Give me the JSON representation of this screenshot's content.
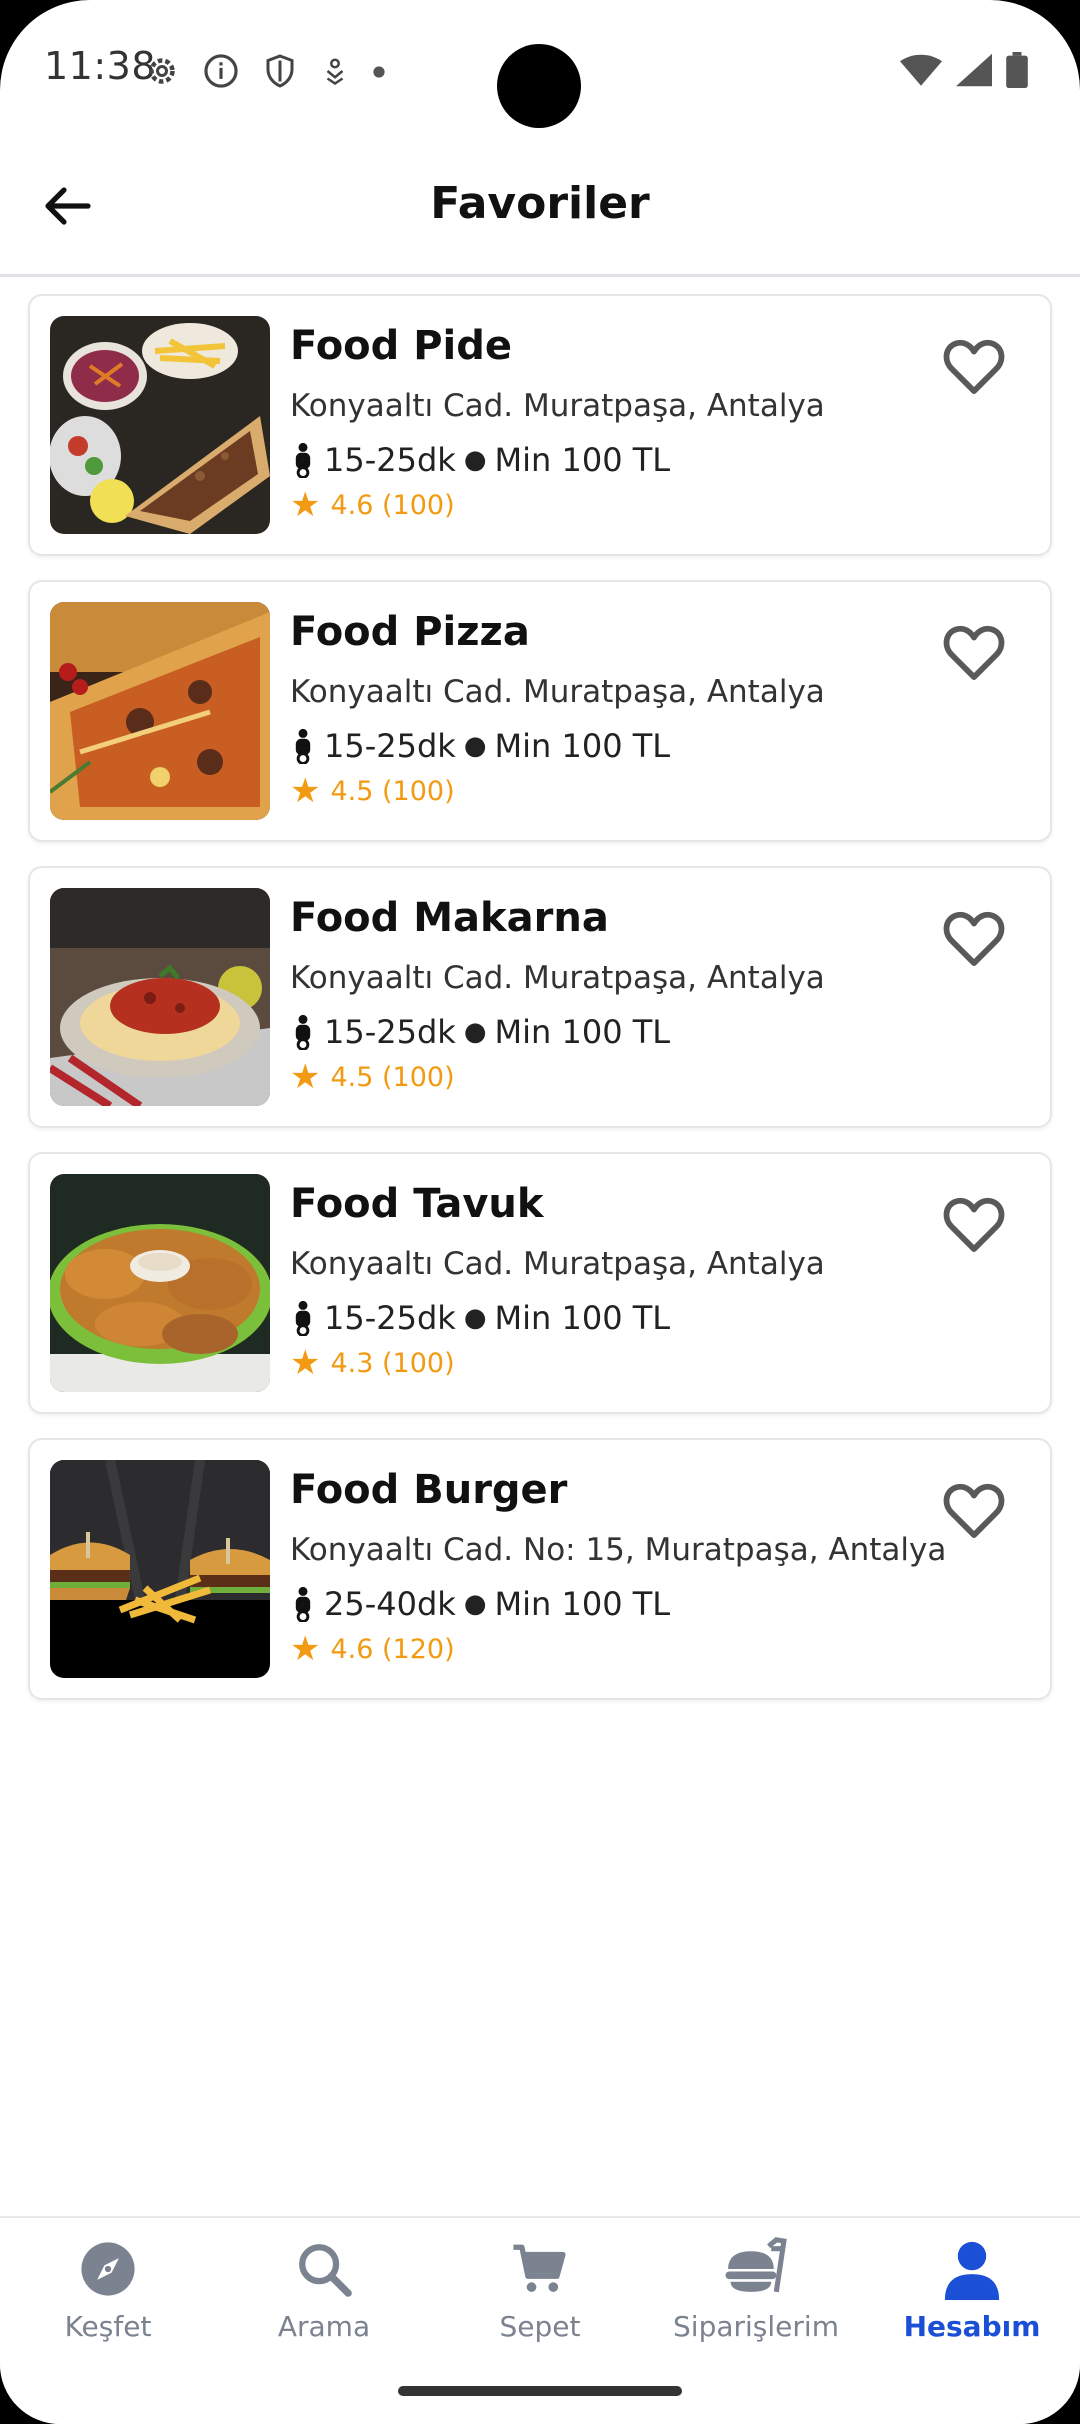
{
  "status_bar": {
    "time": "11:38",
    "icons_left": [
      "gear-icon",
      "info-icon",
      "shield-icon",
      "download-icon",
      "dot-icon"
    ],
    "icons_right": [
      "wifi-icon",
      "signal-icon",
      "battery-icon"
    ]
  },
  "header": {
    "title": "Favoriler",
    "back_icon": "arrow-left-icon"
  },
  "restaurants": [
    {
      "name": "Food Pide",
      "address": "Konyaaltı Cad. Muratpaşa, Antalya",
      "delivery_time": "15-25dk",
      "min_order": "Min 100 TL",
      "rating": "4.6 (100)",
      "favorite_icon": "heart-outline-icon"
    },
    {
      "name": "Food Pizza",
      "address": "Konyaaltı Cad. Muratpaşa, Antalya",
      "delivery_time": "15-25dk",
      "min_order": "Min 100 TL",
      "rating": "4.5 (100)",
      "favorite_icon": "heart-outline-icon"
    },
    {
      "name": "Food Makarna",
      "address": "Konyaaltı Cad. Muratpaşa, Antalya",
      "delivery_time": "15-25dk",
      "min_order": "Min 100 TL",
      "rating": "4.5 (100)",
      "favorite_icon": "heart-outline-icon"
    },
    {
      "name": "Food Tavuk",
      "address": "Konyaaltı Cad. Muratpaşa, Antalya",
      "delivery_time": "15-25dk",
      "min_order": "Min 100 TL",
      "rating": "4.3 (100)",
      "favorite_icon": "heart-outline-icon"
    },
    {
      "name": "Food Burger",
      "address": "Konyaaltı Cad. No: 15, Muratpaşa, Antalya",
      "delivery_time": "25-40dk",
      "min_order": "Min 100 TL",
      "rating": "4.6 (120)",
      "favorite_icon": "heart-outline-icon"
    }
  ],
  "bottom_nav": {
    "items": [
      {
        "label": "Keşfet",
        "icon": "compass-icon",
        "active": false
      },
      {
        "label": "Arama",
        "icon": "search-icon",
        "active": false
      },
      {
        "label": "Sepet",
        "icon": "cart-icon",
        "active": false
      },
      {
        "label": "Siparişlerim",
        "icon": "food-tray-icon",
        "active": false
      },
      {
        "label": "Hesabım",
        "icon": "person-icon",
        "active": true
      }
    ]
  },
  "colors": {
    "accent": "#1a4fd6",
    "rating": "#f29a11",
    "inactive_nav": "#7b8290"
  }
}
